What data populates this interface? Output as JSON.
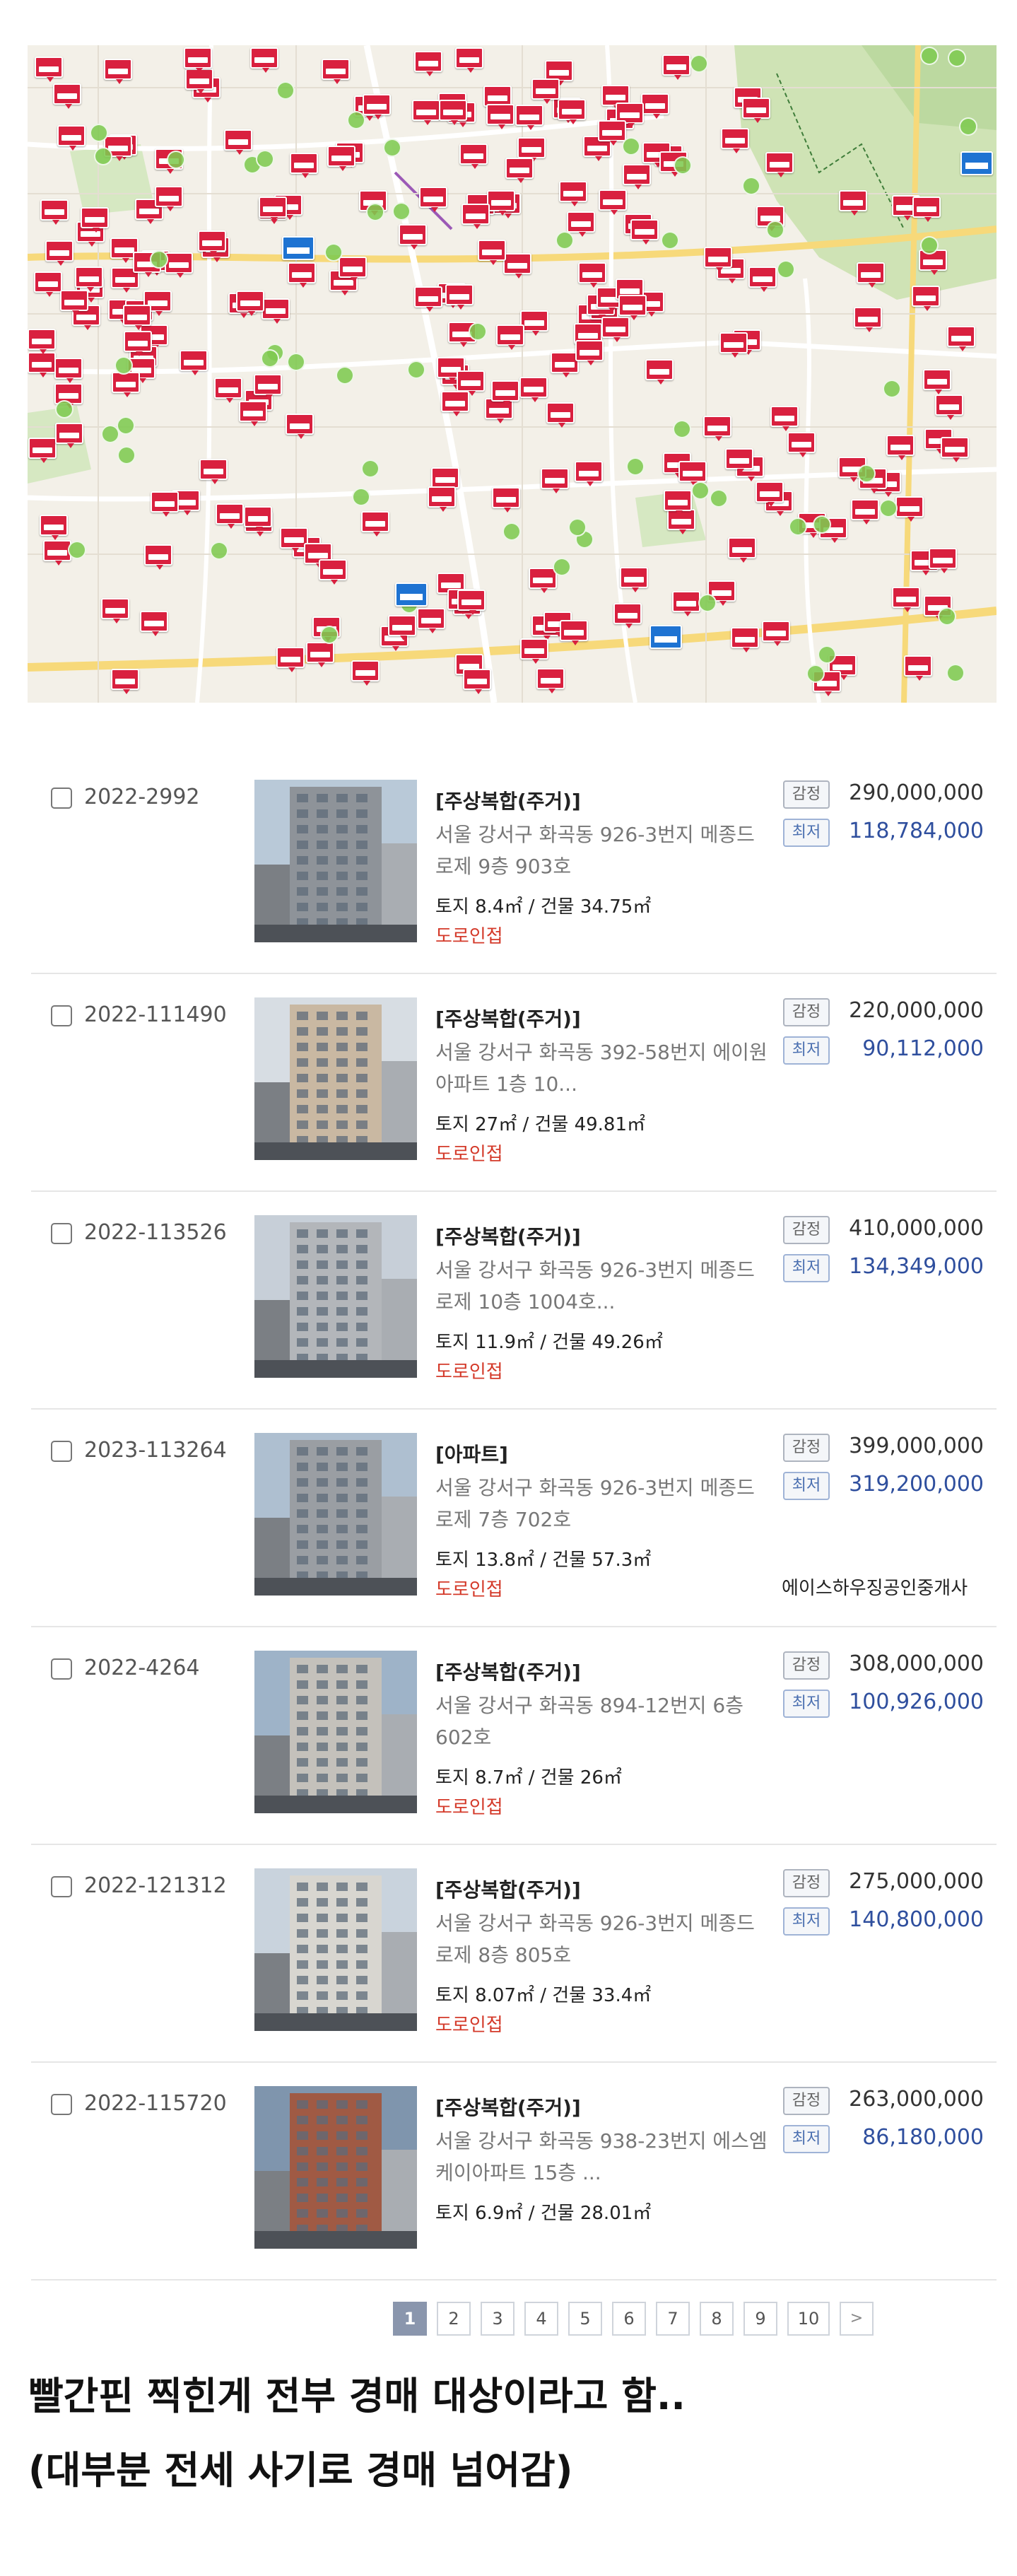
{
  "map": {
    "description_icon": "map-with-auction-pins",
    "pin_color": "#d9203f",
    "cluster_color": "#7ec950",
    "highlight_pin_color": "#1e73d2"
  },
  "listings": [
    {
      "case_no": "2022-2992",
      "type": "[주상복합(주거)]",
      "address": "서울 강서구 화곡동 926-3번지 메종드로제 9층 903호",
      "area": "토지 8.4㎡ / 건물 34.75㎡",
      "road": "도로인접",
      "appraisal_label": "감정",
      "appraisal_price": "290,000,000",
      "minimum_label": "최저",
      "minimum_price": "118,784,000",
      "agent": ""
    },
    {
      "case_no": "2022-111490",
      "type": "[주상복합(주거)]",
      "address": "서울 강서구 화곡동 392-58번지 에이원아파트 1층 10...",
      "area": "토지 27㎡ / 건물 49.81㎡",
      "road": "도로인접",
      "appraisal_label": "감정",
      "appraisal_price": "220,000,000",
      "minimum_label": "최저",
      "minimum_price": "90,112,000",
      "agent": ""
    },
    {
      "case_no": "2022-113526",
      "type": "[주상복합(주거)]",
      "address": "서울 강서구 화곡동 926-3번지 메종드로제 10층 1004호...",
      "area": "토지 11.9㎡ / 건물 49.26㎡",
      "road": "도로인접",
      "appraisal_label": "감정",
      "appraisal_price": "410,000,000",
      "minimum_label": "최저",
      "minimum_price": "134,349,000",
      "agent": ""
    },
    {
      "case_no": "2023-113264",
      "type": "[아파트]",
      "address": "서울 강서구 화곡동 926-3번지 메종드로제 7층 702호",
      "area": "토지 13.8㎡ / 건물 57.3㎡",
      "road": "도로인접",
      "appraisal_label": "감정",
      "appraisal_price": "399,000,000",
      "minimum_label": "최저",
      "minimum_price": "319,200,000",
      "agent": "에이스하우징공인중개사"
    },
    {
      "case_no": "2022-4264",
      "type": "[주상복합(주거)]",
      "address": "서울 강서구 화곡동 894-12번지 6층 602호",
      "area": "토지 8.7㎡ / 건물 26㎡",
      "road": "도로인접",
      "appraisal_label": "감정",
      "appraisal_price": "308,000,000",
      "minimum_label": "최저",
      "minimum_price": "100,926,000",
      "agent": ""
    },
    {
      "case_no": "2022-121312",
      "type": "[주상복합(주거)]",
      "address": "서울 강서구 화곡동 926-3번지 메종드로제 8층 805호",
      "area": "토지 8.07㎡ / 건물 33.4㎡",
      "road": "도로인접",
      "appraisal_label": "감정",
      "appraisal_price": "275,000,000",
      "minimum_label": "최저",
      "minimum_price": "140,800,000",
      "agent": ""
    },
    {
      "case_no": "2022-115720",
      "type": "[주상복합(주거)]",
      "address": "서울 강서구 화곡동 938-23번지 에스엠케이아파트 15층 ...",
      "area": "토지 6.9㎡ / 건물 28.01㎡",
      "road": "",
      "appraisal_label": "감정",
      "appraisal_price": "263,000,000",
      "minimum_label": "최저",
      "minimum_price": "86,180,000",
      "agent": ""
    }
  ],
  "pagination": {
    "pages": [
      "1",
      "2",
      "3",
      "4",
      "5",
      "6",
      "7",
      "8",
      "9",
      "10"
    ],
    "current": "1",
    "next_icon": ">"
  },
  "caption": {
    "line1": "빨간핀 찍힌게 전부 경매 대상이라고 함..",
    "line2": "(대부분 전세 사기로 경매 넘어감)"
  }
}
